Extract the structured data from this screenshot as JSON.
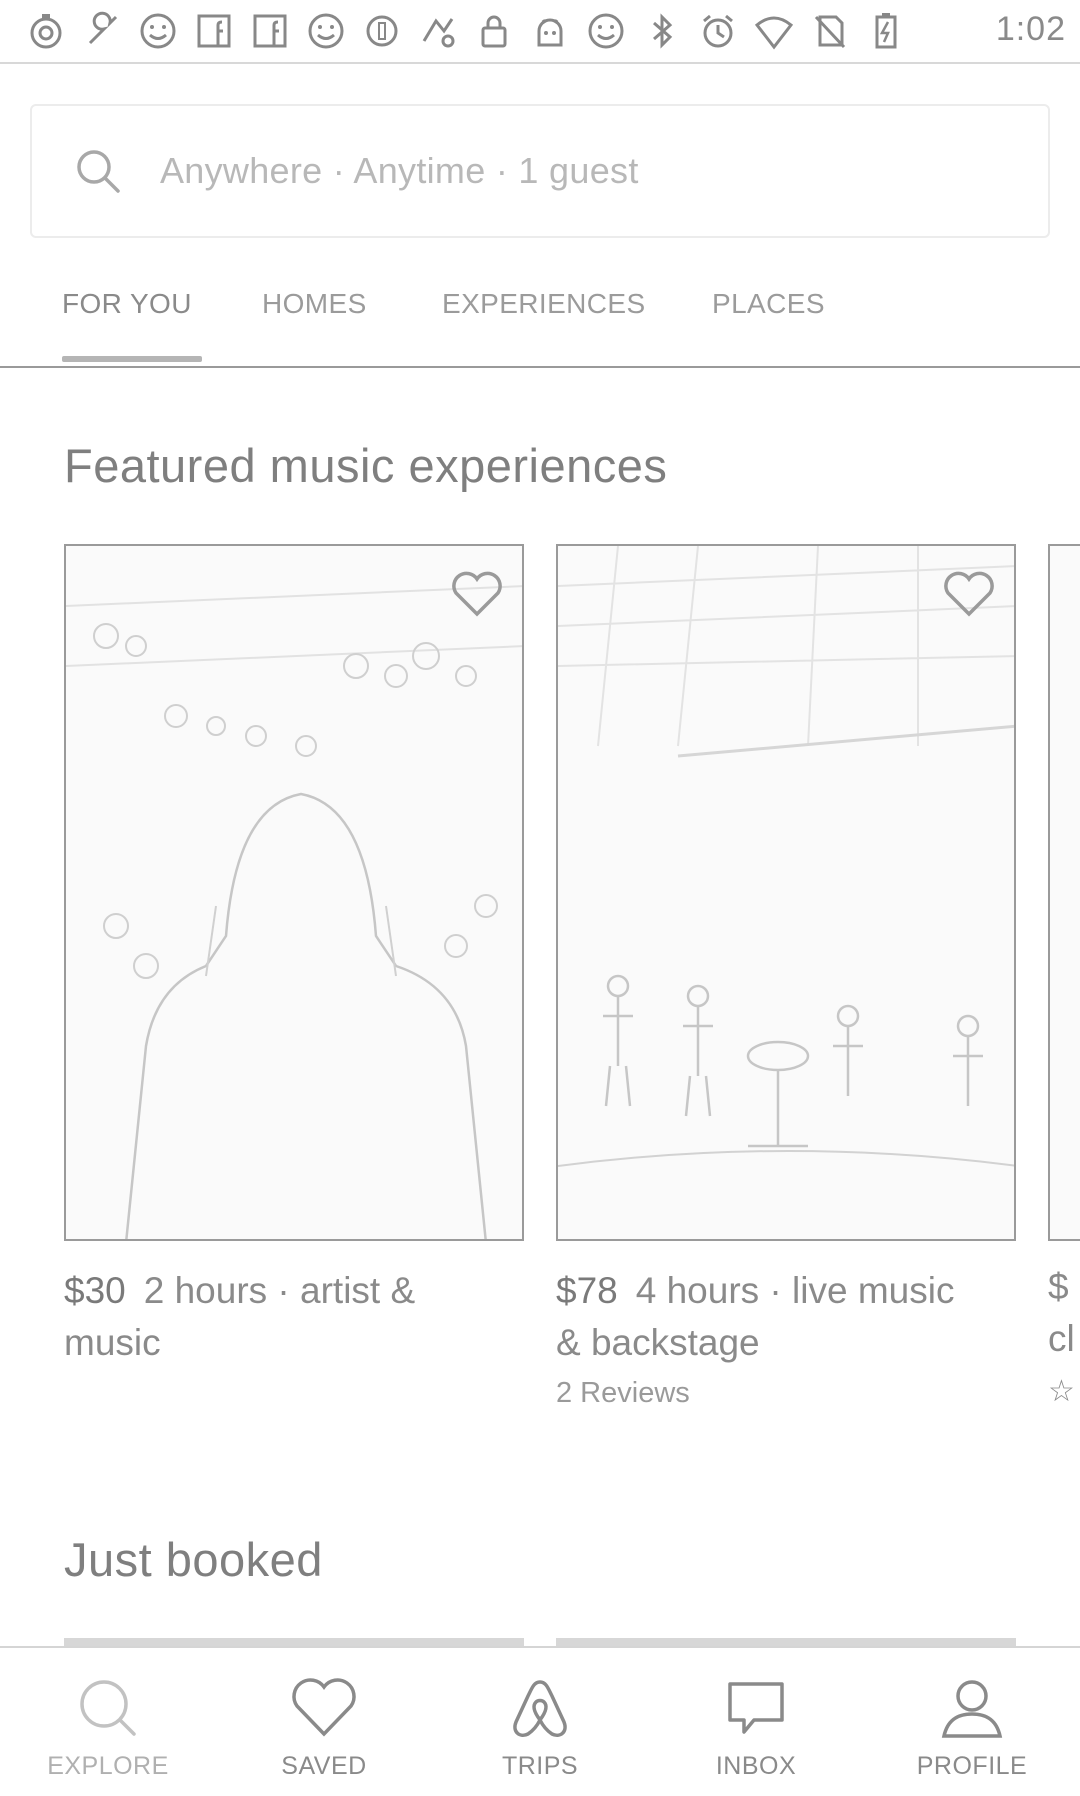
{
  "status_bar": {
    "time": "1:02",
    "icons": [
      "stopwatch-icon",
      "wrench-icon",
      "smiley-icon",
      "facebook-icon",
      "facebook-icon",
      "smiley-icon",
      "circle-icon",
      "app-icon",
      "lock-icon",
      "android-icon",
      "smiley-icon",
      "bluetooth-icon",
      "alarm-icon",
      "wifi-icon",
      "no-sim-icon",
      "battery-charging-icon"
    ]
  },
  "search": {
    "placeholder": "Anywhere · Anytime · 1 guest"
  },
  "tabs": [
    {
      "label": "FOR YOU",
      "active": true
    },
    {
      "label": "HOMES",
      "active": false
    },
    {
      "label": "EXPERIENCES",
      "active": false
    },
    {
      "label": "PLACES",
      "active": false
    }
  ],
  "sections": {
    "featured_title": "Featured music experiences",
    "just_booked_title": "Just booked"
  },
  "cards": [
    {
      "price": "$30",
      "title_line1": "2 hours · artist &",
      "title_line2": "music",
      "reviews": ""
    },
    {
      "price": "$78",
      "title_line1": "4 hours · live music",
      "title_line2": "& backstage",
      "reviews": "2 Reviews"
    }
  ],
  "peek_card": {
    "price_fragment": "$",
    "title_fragment": "cl",
    "star": "☆"
  },
  "bottom_nav": [
    {
      "label": "EXPLORE",
      "icon": "search-icon",
      "active": true
    },
    {
      "label": "SAVED",
      "icon": "heart-icon",
      "active": false
    },
    {
      "label": "TRIPS",
      "icon": "airbnb-logo-icon",
      "active": false
    },
    {
      "label": "INBOX",
      "icon": "chat-icon",
      "active": false
    },
    {
      "label": "PROFILE",
      "icon": "profile-icon",
      "active": false
    }
  ]
}
